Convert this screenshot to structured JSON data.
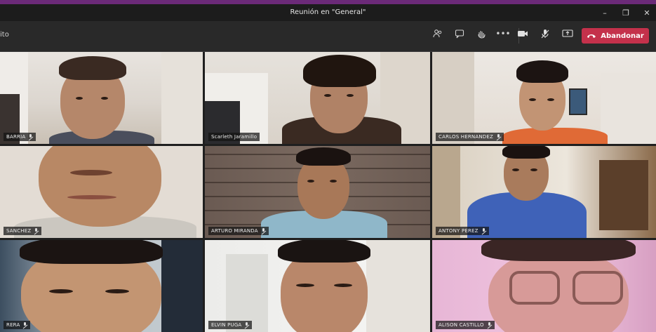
{
  "window": {
    "title": "Reunión en \"General\"",
    "controls": [
      "minimize-icon",
      "maximize-icon",
      "close-icon"
    ]
  },
  "toolbar": {
    "left_label": "ito",
    "icons": [
      "participants-icon",
      "chat-icon",
      "raise-hand-icon",
      "more-options-icon",
      "camera-icon",
      "mic-icon",
      "share-screen-icon"
    ],
    "leave_label": "Abandonar",
    "leave_color": "#c4314b"
  },
  "participants": [
    {
      "name": "BARRIA"
    },
    {
      "name": "Scarleth Jaramillo"
    },
    {
      "name": "CARLOS HERNANDEZ"
    },
    {
      "name": "SANCHEZ"
    },
    {
      "name": "ARTURO MIRANDA"
    },
    {
      "name": "ANTONY PEREZ"
    },
    {
      "name": "RERA"
    },
    {
      "name": "ELVIN PUGA"
    },
    {
      "name": "ALISON CASTILLO"
    }
  ]
}
